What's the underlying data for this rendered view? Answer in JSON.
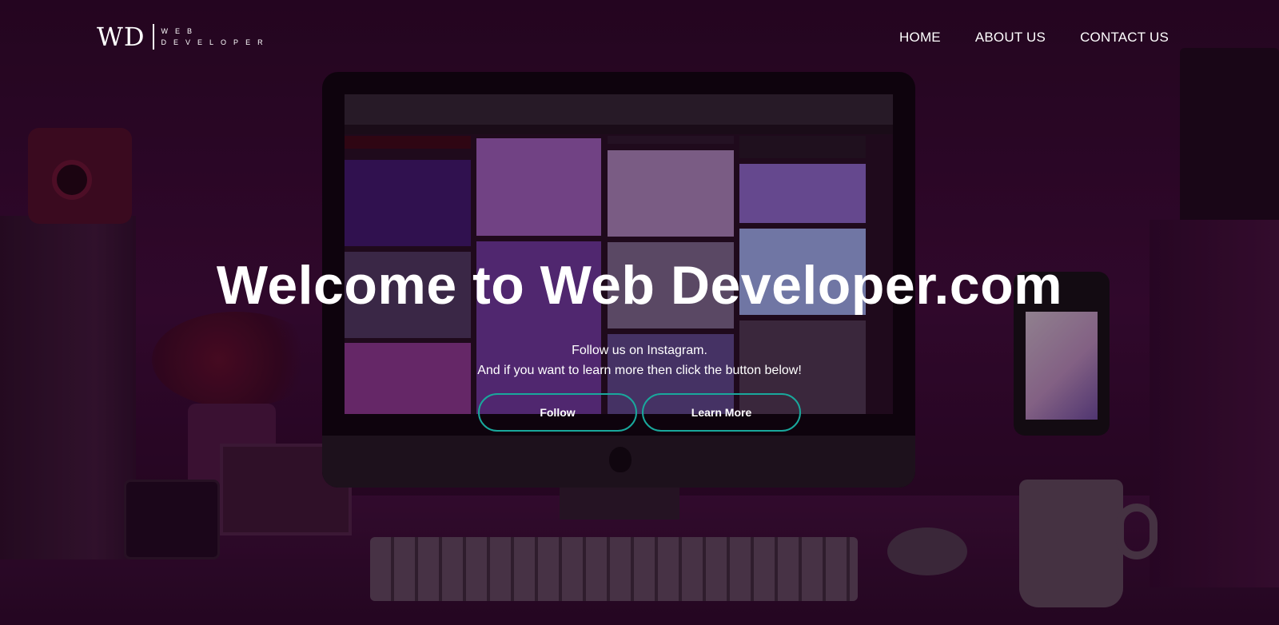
{
  "header": {
    "logo_mark": "WD",
    "logo_line1": "WEB",
    "logo_line2": "DEVELOPER",
    "nav": [
      {
        "label": "HOME"
      },
      {
        "label": "ABOUT US"
      },
      {
        "label": "CONTACT US"
      }
    ]
  },
  "hero": {
    "title": "Welcome to Web Developer.com",
    "line1": "Follow us on Instagram.",
    "line2": "And if you want to learn more then click the button below!",
    "buttons": {
      "follow": "Follow",
      "learn_more": "Learn More"
    }
  },
  "colors": {
    "accent": "#19a89c",
    "overlay": "#3b0c36",
    "text": "#ffffff"
  }
}
